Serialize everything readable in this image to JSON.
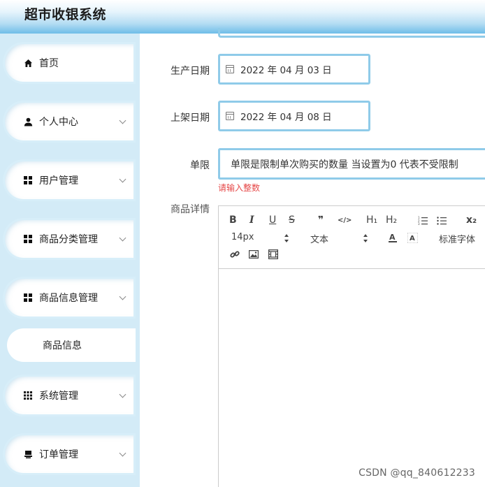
{
  "app": {
    "title": "超市收银系统"
  },
  "sidebar": {
    "items": [
      {
        "label": "首页",
        "icon": "home-icon"
      },
      {
        "label": "个人中心",
        "icon": "user-icon"
      },
      {
        "label": "用户管理",
        "icon": "grid-icon"
      },
      {
        "label": "商品分类管理",
        "icon": "grid-icon"
      },
      {
        "label": "商品信息管理",
        "icon": "grid-icon"
      },
      {
        "label": "商品信息",
        "icon": ""
      },
      {
        "label": "系统管理",
        "icon": "apps-icon"
      },
      {
        "label": "订单管理",
        "icon": "order-icon"
      }
    ]
  },
  "form": {
    "production_date": {
      "label": "生产日期",
      "value": "2022 年 04 月 03 日"
    },
    "shelf_date": {
      "label": "上架日期",
      "value": "2022 年 04 月 08 日"
    },
    "limit": {
      "label": "单限",
      "value": "单限是限制单次购买的数量 当设置为0 代表不受限制",
      "error": "请输入整数"
    },
    "details": {
      "label": "商品详情"
    }
  },
  "editor": {
    "font_size": "14px",
    "block_type": "文本",
    "font_family": "标准字体",
    "buttons": {
      "bold": "B",
      "italic": "I",
      "underline": "U",
      "strike": "S",
      "quote": "❞",
      "code": "</>",
      "h1": "H₁",
      "h2": "H₂",
      "subscript": "x₂"
    }
  },
  "watermark": "CSDN @qq_840612233",
  "colors": {
    "accent": "#8fcbe9",
    "sidebar_bg": "#d3ebf7",
    "error": "#e64949"
  }
}
